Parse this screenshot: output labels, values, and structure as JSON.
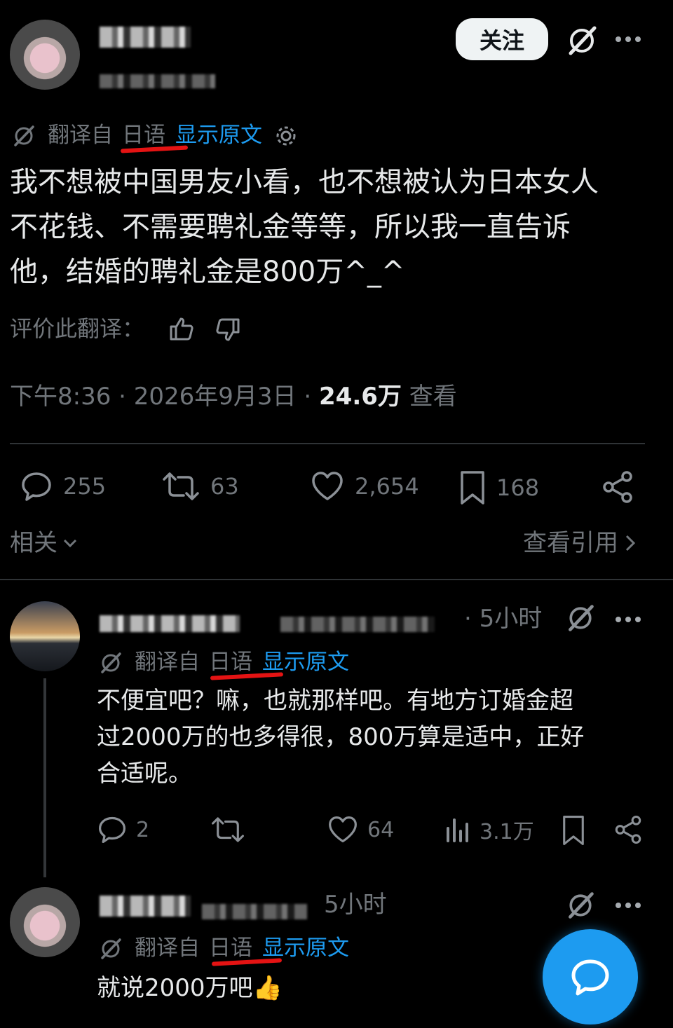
{
  "post": {
    "follow_label": "关注",
    "translate_prefix": "翻译自",
    "translate_lang": "日语",
    "show_original": "显示原文",
    "text_lines": [
      "我不想被中国男友小看，也不想被认为日本女人",
      "不花钱、不需要聘礼金等等，所以我一直告诉",
      "他，结婚的聘礼金是800万^_^"
    ],
    "rate_translation": "评价此翻译：",
    "timestamp": "下午8:36 · 2026年9月3日 · ",
    "views_count": "24.6万",
    "views_label": " 查看",
    "stats": {
      "replies": "255",
      "reposts": "63",
      "likes": "2,654",
      "bookmarks": "168"
    },
    "related_label": "相关",
    "view_quotes_label": "查看引用"
  },
  "reply1": {
    "time": "· 5小时",
    "translate_prefix": "翻译自",
    "translate_lang": "日语",
    "show_original": "显示原文",
    "text_lines": [
      "不便宜吧？嘛，也就那样吧。有地方订婚金超",
      "过2000万的也多得很，800万算是适中，正好",
      "合适呢。"
    ],
    "stats": {
      "replies": "2",
      "likes": "64",
      "views": "3.1万"
    }
  },
  "reply2": {
    "time": "5小时",
    "translate_prefix": "翻译自",
    "translate_lang": "日语",
    "show_original": "显示原文",
    "text": "就说2000万吧👍"
  },
  "icons": {
    "grok": "grok-slash-icon",
    "more": "more-dots-icon",
    "settings": "gear-icon",
    "thumbs_up": "thumbs-up-icon",
    "thumbs_down": "thumbs-down-icon",
    "reply": "reply-bubble-icon",
    "repost": "repost-icon",
    "like": "heart-icon",
    "bookmark": "bookmark-icon",
    "share": "share-icon",
    "views": "views-bars-icon",
    "compose": "compose-reply-icon"
  },
  "colors": {
    "background": "#000000",
    "accent": "#1d9bf0",
    "text": "#e7e9ea",
    "muted": "#71767b",
    "underline": "#e41313"
  }
}
